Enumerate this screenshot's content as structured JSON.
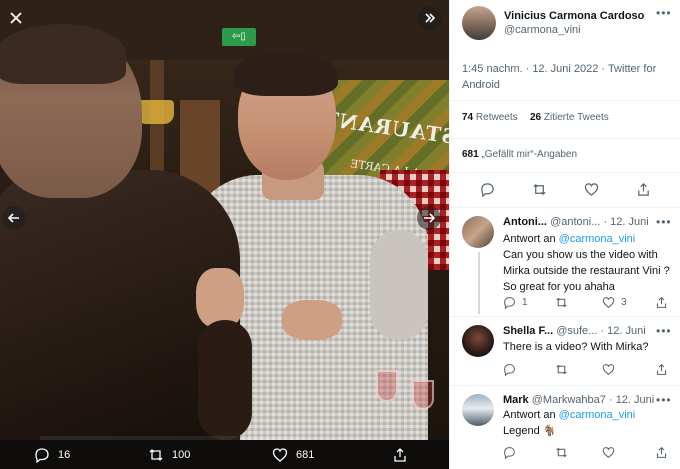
{
  "viewer": {
    "close_icon": "close-icon",
    "expand_icon": "expand-icon",
    "prev_icon": "chevron-left-icon",
    "next_icon": "chevron-right-icon",
    "photo": {
      "sign_text": "RESTAURANT",
      "sign_sub": "A LA CARTE"
    },
    "actions": {
      "replies": "16",
      "retweets": "100",
      "likes": "681"
    }
  },
  "tweet": {
    "author_name": "Vinicius Carmona Cardoso",
    "author_handle": "@carmona_vini",
    "meta": "1:45 nachm. · 12. Juni 2022 · Twitter for Android",
    "stats": {
      "retweets_count": "74",
      "retweets_label": "Retweets",
      "quotes_count": "26",
      "quotes_label": "Zitierte Tweets",
      "likes_count": "681",
      "likes_label": "„Gefällt mir“-Angaben"
    }
  },
  "replies": [
    {
      "name": "Antoni...",
      "handle": "@antoni...",
      "date": "· 12. Juni",
      "reply_prefix": "Antwort an",
      "reply_to": "@carmona_vini",
      "text": "Can you show us the video with Mirka outside the restaurant Vini ? So great for you ahaha",
      "reply_count": "1",
      "like_count": "3"
    },
    {
      "name": "Shella F...",
      "handle": "@sufe...",
      "date": "· 12. Juni",
      "text": "There is a video? With Mirka?"
    },
    {
      "name": "Mark",
      "handle": "@Markwahba7",
      "date": "· 12. Juni",
      "reply_prefix": "Antwort an",
      "reply_to": "@carmona_vini",
      "text": "Legend 🐐"
    }
  ],
  "colors": {
    "accent": "#1d9bf0",
    "text": "#0f1419",
    "muted": "#536471",
    "viewer_bg": "#0f0d0b"
  }
}
